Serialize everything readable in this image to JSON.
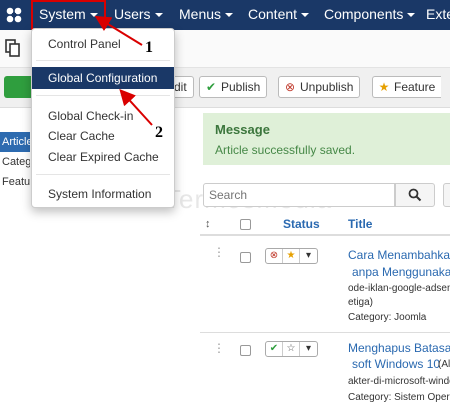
{
  "navbar": {
    "items": [
      {
        "label": "System"
      },
      {
        "label": "Users"
      },
      {
        "label": "Menus"
      },
      {
        "label": "Content"
      },
      {
        "label": "Components"
      },
      {
        "label": "Exte"
      }
    ]
  },
  "toolbar": {
    "edit_label": "dit",
    "publish_label": "Publish",
    "unpublish_label": "Unpublish",
    "feature_label": "Feature"
  },
  "sidebar": {
    "items": [
      {
        "label": "Article"
      },
      {
        "label": "Categ"
      },
      {
        "label": "Featu"
      }
    ]
  },
  "message": {
    "title": "Message",
    "body": "Article successfully saved."
  },
  "search": {
    "placeholder": "Search"
  },
  "table": {
    "columns": {
      "status": "Status",
      "title": "Title"
    },
    "sort_arrow": "↕",
    "rows": [
      {
        "title_line1": "Cara Menambahkan",
        "title_line2": "anpa Menggunakan",
        "alias_line1": "ode-iklan-google-adsen",
        "alias_line2": "etiga)",
        "category": "Category: Joomla"
      },
      {
        "title_line1": "Menghapus Batasar",
        "title_line2": "soft Windows 10",
        "title_suffix": "(Ali",
        "alias_line1": "akter-di-microsoft-windo",
        "category": "Category: Sistem Operas"
      }
    ]
  },
  "dropdown": {
    "items": [
      {
        "label": "Control Panel"
      },
      {
        "label": "Global Configuration"
      },
      {
        "label": "Global Check-in"
      },
      {
        "label": "Clear Cache"
      },
      {
        "label": "Clear Expired Cache"
      },
      {
        "label": "System Information"
      }
    ]
  },
  "annotations": {
    "one": "1",
    "two": "2"
  },
  "watermark": "TermosMedia",
  "colors": {
    "navbar": "#1a3867",
    "highlight": "#1a3867",
    "accent_red": "#d90000",
    "message_bg": "#dff0d8",
    "link": "#2a69b0"
  }
}
